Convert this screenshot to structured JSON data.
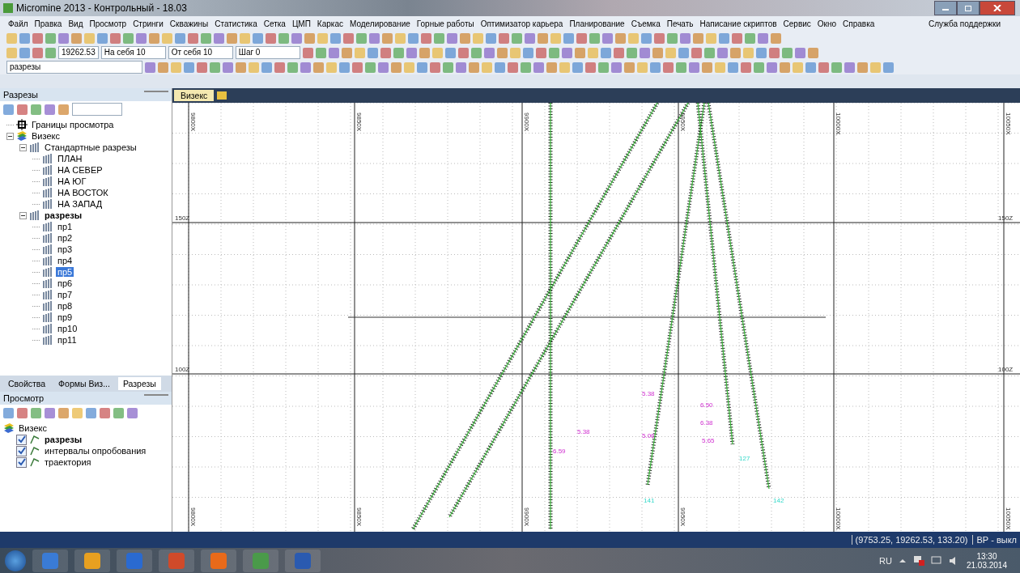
{
  "window": {
    "title": "Micromine 2013 - Контрольный - 18.03"
  },
  "menu": [
    "Файл",
    "Правка",
    "Вид",
    "Просмотр",
    "Стринги",
    "Скважины",
    "Статистика",
    "Сетка",
    "ЦМП",
    "Каркас",
    "Моделирование",
    "Горные работы",
    "Оптимизатор карьера",
    "Планирование",
    "Съемка",
    "Печать",
    "Написание скриптов",
    "Сервис",
    "Окно",
    "Справка"
  ],
  "support_link": "Служба поддержки",
  "toolbar": {
    "coordinate": "19262.53",
    "dropdowns": [
      "На себя 10",
      "От себя 10",
      "Шаг 0"
    ],
    "section_select": "разрезы"
  },
  "sections_panel": {
    "title": "Разрезы",
    "tree": [
      {
        "label": "Границы просмотра",
        "bold": false,
        "selected": false,
        "kind": "bounds"
      },
      {
        "label": "Визекс",
        "bold": false,
        "selected": false,
        "kind": "layers",
        "children": [
          {
            "label": "Стандартные разрезы",
            "bold": false,
            "selected": false,
            "kind": "section",
            "children": [
              {
                "label": "ПЛАН",
                "bold": false,
                "selected": false,
                "kind": "section"
              },
              {
                "label": "НА СЕВЕР",
                "bold": false,
                "selected": false,
                "kind": "section"
              },
              {
                "label": "НА ЮГ",
                "bold": false,
                "selected": false,
                "kind": "section"
              },
              {
                "label": "НА ВОСТОК",
                "bold": false,
                "selected": false,
                "kind": "section"
              },
              {
                "label": "НА ЗАПАД",
                "bold": false,
                "selected": false,
                "kind": "section"
              }
            ]
          },
          {
            "label": "разрезы",
            "bold": true,
            "selected": false,
            "kind": "section",
            "children": [
              {
                "label": "пр1",
                "bold": false,
                "selected": false,
                "kind": "section"
              },
              {
                "label": "пр2",
                "bold": false,
                "selected": false,
                "kind": "section"
              },
              {
                "label": "пр3",
                "bold": false,
                "selected": false,
                "kind": "section"
              },
              {
                "label": "пр4",
                "bold": false,
                "selected": false,
                "kind": "section"
              },
              {
                "label": "пр5",
                "bold": false,
                "selected": true,
                "kind": "section"
              },
              {
                "label": "пр6",
                "bold": false,
                "selected": false,
                "kind": "section"
              },
              {
                "label": "пр7",
                "bold": false,
                "selected": false,
                "kind": "section"
              },
              {
                "label": "пр8",
                "bold": false,
                "selected": false,
                "kind": "section"
              },
              {
                "label": "пр9",
                "bold": false,
                "selected": false,
                "kind": "section"
              },
              {
                "label": "пр10",
                "bold": false,
                "selected": false,
                "kind": "section"
              },
              {
                "label": "пр11",
                "bold": false,
                "selected": false,
                "kind": "section"
              }
            ]
          }
        ]
      }
    ]
  },
  "panel_tabs": [
    {
      "label": "Свойства",
      "selected": false
    },
    {
      "label": "Формы Виз...",
      "selected": false
    },
    {
      "label": "Разрезы",
      "selected": true
    }
  ],
  "view_panel": {
    "title": "Просмотр",
    "root": "Визекс",
    "layers": [
      {
        "label": "разрезы",
        "checked": true,
        "bold": true
      },
      {
        "label": "интервалы опробования",
        "checked": true,
        "bold": false
      },
      {
        "label": "траектория",
        "checked": true,
        "bold": false
      }
    ]
  },
  "document_tab": {
    "label": "Визекс"
  },
  "canvas": {
    "x_labels_top": [
      "9800X",
      "9850X",
      "9900X",
      "9950X",
      "10000X",
      "10050X"
    ],
    "x_labels_bottom": [
      "9800X",
      "9850X",
      "9900X",
      "9950X",
      "10000X",
      "10050X"
    ],
    "z_labels_left": [
      "150Z",
      "100Z"
    ],
    "z_labels_right": [
      "150Z",
      "100Z"
    ],
    "hole_labels": [
      "127",
      "141",
      "142"
    ],
    "values": [
      "5.38",
      "5.06",
      "5.38",
      "6.59",
      "6.50",
      "6.38",
      "5.65"
    ]
  },
  "status_bar": {
    "coordinates": "(9753.25, 19262.53, 133.20)",
    "mode": "ВР - выкл"
  },
  "taskbar": {
    "language": "RU",
    "time": "13:30",
    "date": "21.03.2014"
  }
}
